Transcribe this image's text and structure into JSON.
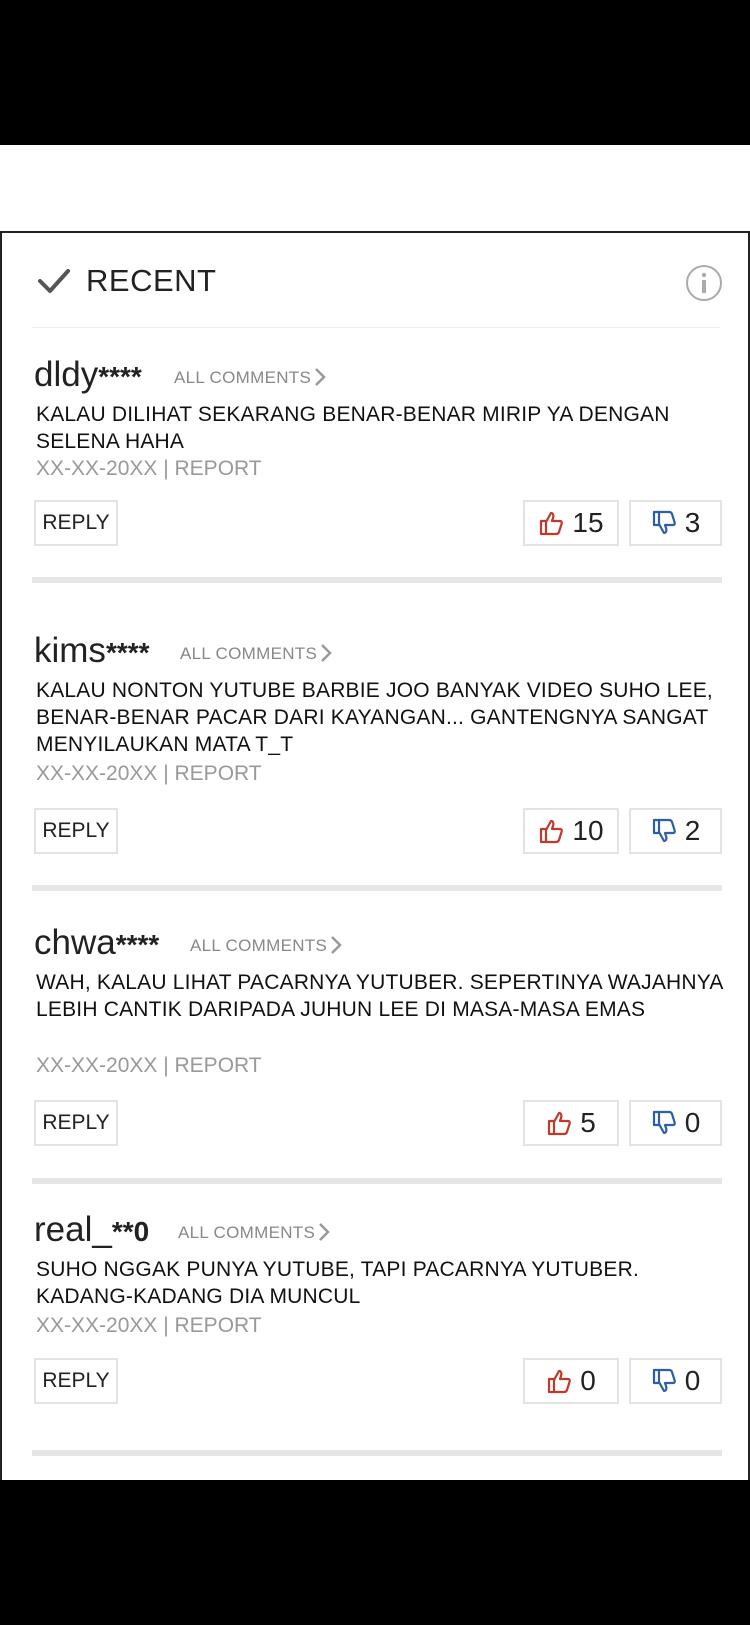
{
  "header": {
    "title": "RECENT",
    "check_icon": "check-icon",
    "info_icon": "info-icon"
  },
  "labels": {
    "all_comments": "ALL COMMENTS",
    "reply": "REPLY"
  },
  "colors": {
    "like": "#c0392b",
    "dislike": "#2e5ea8"
  },
  "comments": [
    {
      "user": "dldy",
      "stars": "****",
      "text": "KALAU DILIHAT SEKARANG BENAR-BENAR MIRIP YA DENGAN SELENA HAHA",
      "meta": "XX-XX-20XX | REPORT",
      "likes": "15",
      "dislikes": "3"
    },
    {
      "user": "kims",
      "stars": "****",
      "text": "KALAU NONTON YUTUBE BARBIE JOO BANYAK VIDEO SUHO LEE, BENAR-BENAR PACAR DARI KAYANGAN... GANTENGNYA SANGAT MENYILAUKAN MATA T_T",
      "meta": "XX-XX-20XX | REPORT",
      "likes": "10",
      "dislikes": "2"
    },
    {
      "user": "chwa",
      "stars": "****",
      "text": "WAH, KALAU LIHAT PACARNYA YUTUBER. SEPERTINYA WAJAHNYA LEBIH CANTIK DARIPADA JUHUN LEE DI MASA-MASA EMAS",
      "meta": "XX-XX-20XX | REPORT",
      "likes": "5",
      "dislikes": "0"
    },
    {
      "user": "real_",
      "stars": "**0",
      "text": "SUHO NGGAK PUNYA YUTUBE, TAPI PACARNYA YUTUBER. KADANG-KADANG DIA MUNCUL",
      "meta": "XX-XX-20XX | REPORT",
      "likes": "0",
      "dislikes": "0"
    }
  ]
}
